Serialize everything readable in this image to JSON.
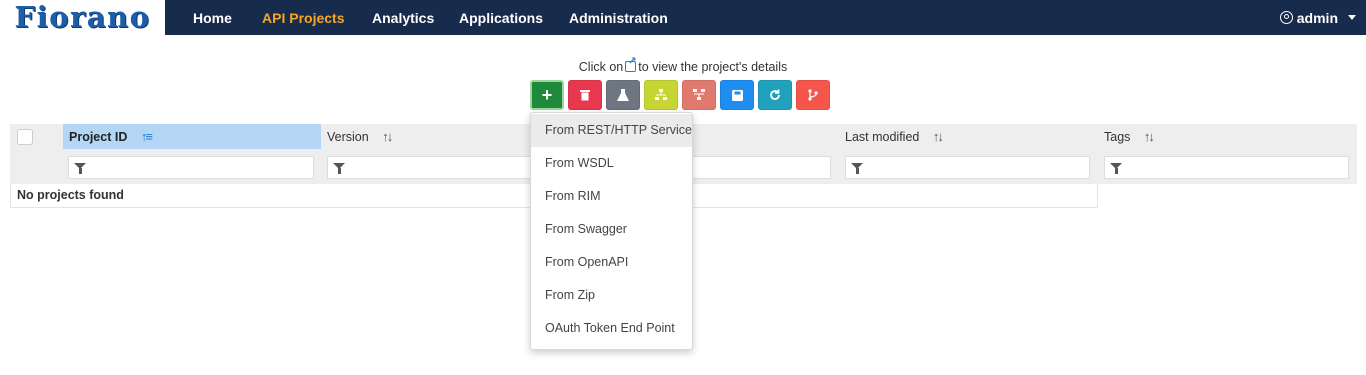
{
  "brand": {
    "logo_text": "Fiorano"
  },
  "nav": {
    "items": [
      {
        "label": "Home",
        "active": false
      },
      {
        "label": "API Projects",
        "active": true
      },
      {
        "label": "Analytics",
        "active": false
      },
      {
        "label": "Applications",
        "active": false
      },
      {
        "label": "Administration",
        "active": false
      }
    ],
    "user": {
      "name": "admin",
      "icon": "user-circle-icon"
    }
  },
  "hint": {
    "before": "Click on",
    "after": "to view the project's details",
    "icon": "external-link-icon"
  },
  "toolbar": {
    "buttons": [
      {
        "name": "add",
        "icon": "plus-icon",
        "glyph": "+",
        "color": "#1e8a3c"
      },
      {
        "name": "delete",
        "icon": "trash-icon",
        "glyph": "",
        "color": "#e8384f"
      },
      {
        "name": "import",
        "icon": "flask-icon",
        "glyph": "",
        "color": "#6e7681"
      },
      {
        "name": "deploy",
        "icon": "sitemap-icon",
        "glyph": "",
        "color": "#c6d534"
      },
      {
        "name": "undeploy",
        "icon": "sitemap-down-icon",
        "glyph": "",
        "color": "#e07a6e"
      },
      {
        "name": "save",
        "icon": "save-icon",
        "glyph": "",
        "color": "#1f8ef1"
      },
      {
        "name": "refresh",
        "icon": "refresh-icon",
        "glyph": "",
        "color": "#20a2bf"
      },
      {
        "name": "branch",
        "icon": "branch-icon",
        "glyph": "",
        "color": "#f4564c"
      }
    ]
  },
  "table": {
    "columns": [
      {
        "label": "Project ID",
        "sorted": true
      },
      {
        "label": "Version",
        "sorted": false
      },
      {
        "label": "",
        "sorted": false
      },
      {
        "label": "Last modified",
        "sorted": false
      },
      {
        "label": "Tags",
        "sorted": false
      }
    ],
    "empty_message": "No projects found"
  },
  "dropdown": {
    "items": [
      {
        "label": "From REST/HTTP Service",
        "highlighted": true
      },
      {
        "label": "From WSDL",
        "highlighted": false
      },
      {
        "label": "From RIM",
        "highlighted": false
      },
      {
        "label": "From Swagger",
        "highlighted": false
      },
      {
        "label": "From OpenAPI",
        "highlighted": false
      },
      {
        "label": "From Zip",
        "highlighted": false
      },
      {
        "label": "OAuth Token End Point",
        "highlighted": false
      }
    ]
  }
}
